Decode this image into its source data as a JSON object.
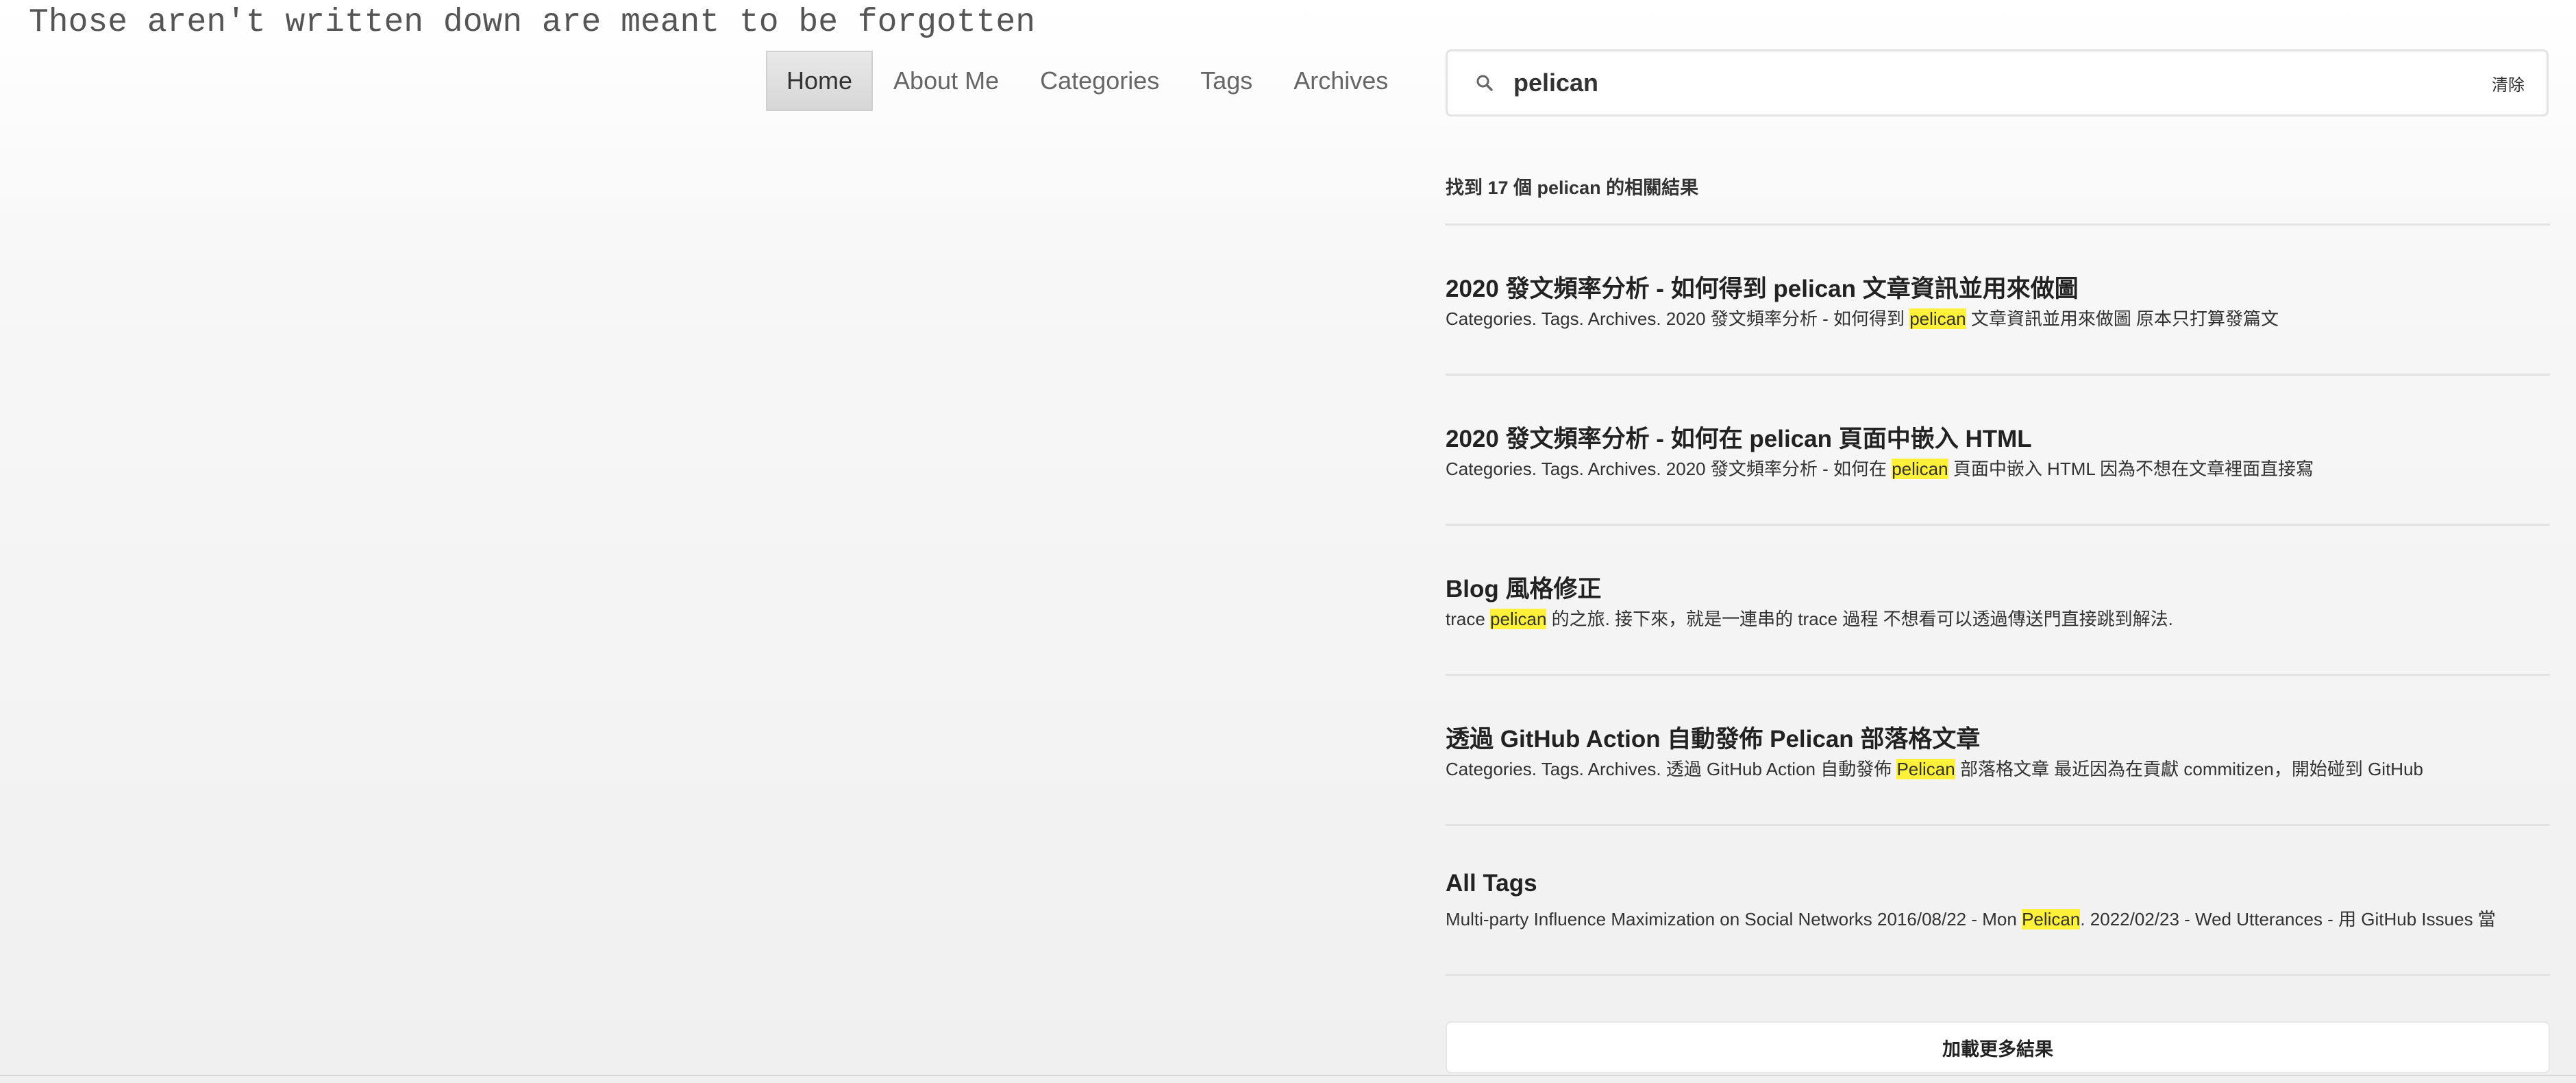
{
  "site": {
    "title": "Those aren't written down are meant to be forgotten"
  },
  "nav": {
    "items": [
      {
        "label": "Home",
        "active": true
      },
      {
        "label": "About Me"
      },
      {
        "label": "Categories"
      },
      {
        "label": "Tags"
      },
      {
        "label": "Archives"
      }
    ]
  },
  "search": {
    "value": "pelican",
    "icon": "search-icon",
    "clear_label": "清除"
  },
  "results": {
    "summary": "找到 17 個 pelican 的相關結果",
    "items": [
      {
        "title": "2020 發文頻率分析 - 如何得到 pelican 文章資訊並用來做圖",
        "excerpt_before": "Categories. Tags. Archives. 2020 發文頻率分析 - 如何得到 ",
        "excerpt_match": "pelican",
        "excerpt_after": " 文章資訊並用來做圖 原本只打算發篇文"
      },
      {
        "title": "2020 發文頻率分析 - 如何在 pelican 頁面中嵌入 HTML",
        "excerpt_before": "Categories. Tags. Archives. 2020 發文頻率分析 - 如何在 ",
        "excerpt_match": "pelican",
        "excerpt_after": " 頁面中嵌入 HTML 因為不想在文章裡面直接寫"
      },
      {
        "title": "Blog 風格修正",
        "excerpt_before": "trace ",
        "excerpt_match": "pelican",
        "excerpt_after": " 的之旅. 接下來，就是一連串的 trace 過程 不想看可以透過傳送門直接跳到解法."
      },
      {
        "title": "透過 GitHub Action 自動發佈 Pelican 部落格文章",
        "excerpt_before": "Categories. Tags. Archives. 透過 GitHub Action 自動發佈 ",
        "excerpt_match": "Pelican",
        "excerpt_after": " 部落格文章 最近因為在貢獻 commitizen，開始碰到 GitHub"
      },
      {
        "title": "All Tags",
        "excerpt_before": "Multi-party Influence Maximization on Social Networks 2016/08/22 - Mon ",
        "excerpt_match": "Pelican",
        "excerpt_after": ". 2022/02/23 - Wed Utterances - 用 GitHub Issues 當"
      }
    ],
    "load_more_label": "加載更多結果"
  }
}
